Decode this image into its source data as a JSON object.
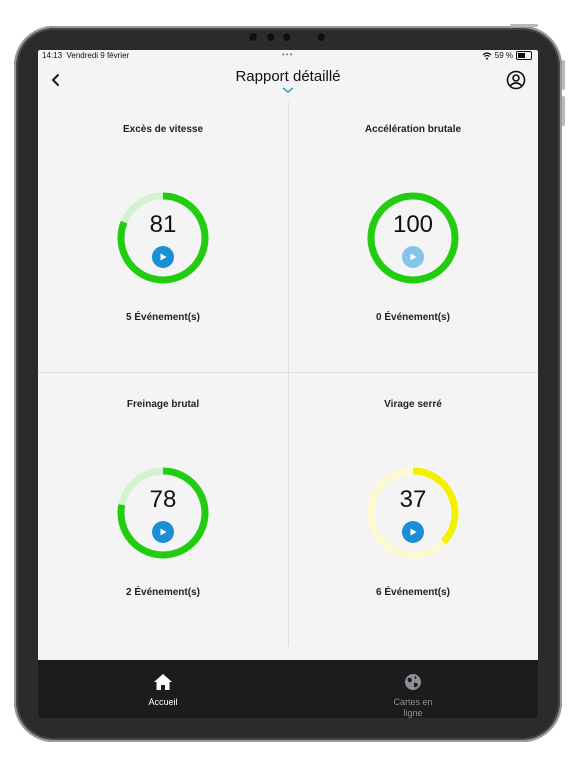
{
  "status_bar": {
    "time": "14:13",
    "date": "Vendredi 9 février",
    "battery": "59 %",
    "battery_level": 0.59
  },
  "header": {
    "title": "Rapport détaillé"
  },
  "cells": [
    {
      "label": "Excès de vitesse",
      "score": "81",
      "score_value": 81,
      "events": "5 Événement(s)",
      "color": "#22cc11",
      "track_color": "#d3f2cf",
      "play_color": "#1a8fd8"
    },
    {
      "label": "Accélération brutale",
      "score": "100",
      "score_value": 100,
      "events": "0 Événement(s)",
      "color": "#22cc11",
      "track_color": "#d3f2cf",
      "play_color": "#86c4ea"
    },
    {
      "label": "Freinage brutal",
      "score": "78",
      "score_value": 78,
      "events": "2 Événement(s)",
      "color": "#22cc11",
      "track_color": "#d3f2cf",
      "play_color": "#1a8fd8"
    },
    {
      "label": "Virage serré",
      "score": "37",
      "score_value": 37,
      "events": "6 Événement(s)",
      "color": "#f2f200",
      "track_color": "#fbfbcf",
      "play_color": "#1a8fd8"
    }
  ],
  "tabbar": {
    "tabs": [
      {
        "label": "Accueil",
        "icon": "home-icon",
        "active": true
      },
      {
        "label": "Cartes en ligne",
        "icon": "globe-icon",
        "active": false
      }
    ]
  }
}
